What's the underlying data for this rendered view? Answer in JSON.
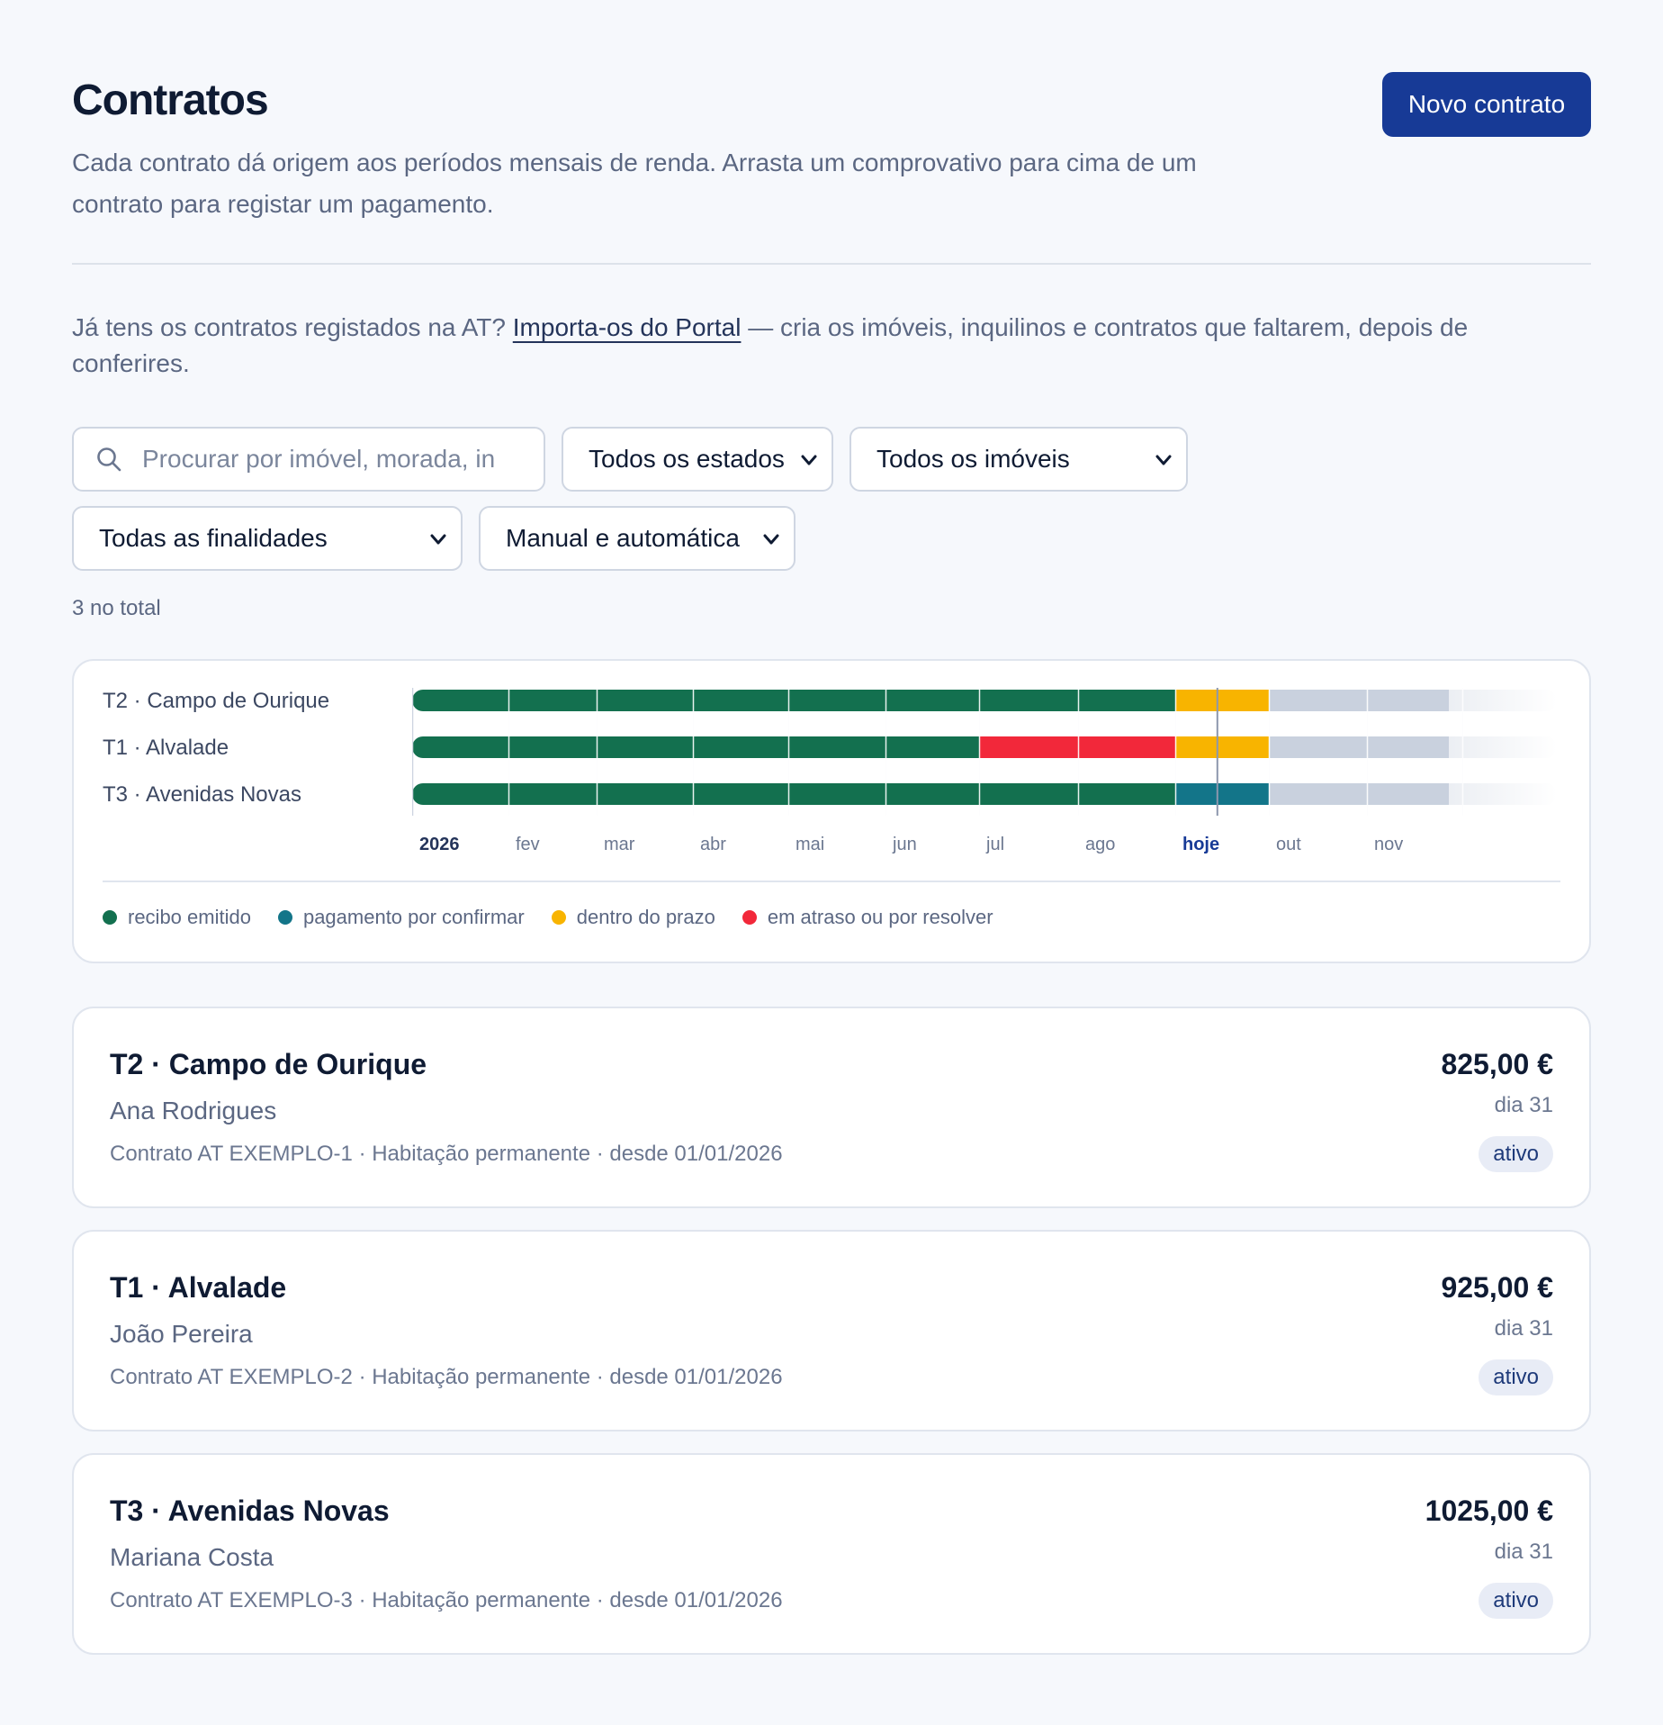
{
  "header": {
    "title": "Contratos",
    "subtitle": "Cada contrato dá origem aos períodos mensais de renda. Arrasta um comprovativo para cima de um contrato para registar um pagamento.",
    "new_button": "Novo contrato"
  },
  "import": {
    "prefix": "Já tens os contratos registados na AT? ",
    "link": "Importa-os do Portal",
    "suffix": " — cria os imóveis, inquilinos e contratos que faltarem, depois de conferires."
  },
  "filters": {
    "search_placeholder": "Procurar por imóvel, morada, in",
    "estados": "Todos os estados",
    "imoveis": "Todos os imóveis",
    "finalidades": "Todas as finalidades",
    "modo": "Manual e automática"
  },
  "count": "3 no total",
  "colors": {
    "recibo_emitido": "#13704f",
    "pagamento_por_confirmar": "#137589",
    "dentro_do_prazo": "#f8b400",
    "em_atraso": "#f2283a",
    "futuro": "#c9d1de",
    "accent": "#173a96"
  },
  "timeline": {
    "rows": [
      {
        "label": "T2 · Campo de Ourique",
        "statuses": [
          "recibo_emitido",
          "recibo_emitido",
          "recibo_emitido",
          "recibo_emitido",
          "recibo_emitido",
          "recibo_emitido",
          "recibo_emitido",
          "recibo_emitido",
          "dentro_do_prazo",
          "futuro",
          "futuro",
          "futuro"
        ]
      },
      {
        "label": "T1 · Alvalade",
        "statuses": [
          "recibo_emitido",
          "recibo_emitido",
          "recibo_emitido",
          "recibo_emitido",
          "recibo_emitido",
          "recibo_emitido",
          "em_atraso",
          "em_atraso",
          "dentro_do_prazo",
          "futuro",
          "futuro",
          "futuro"
        ]
      },
      {
        "label": "T3 · Avenidas Novas",
        "statuses": [
          "recibo_emitido",
          "recibo_emitido",
          "recibo_emitido",
          "recibo_emitido",
          "recibo_emitido",
          "recibo_emitido",
          "recibo_emitido",
          "recibo_emitido",
          "pagamento_por_confirmar",
          "futuro",
          "futuro",
          "futuro"
        ]
      }
    ],
    "months": [
      "2026",
      "fev",
      "mar",
      "abr",
      "mai",
      "jun",
      "jul",
      "ago",
      "hoje",
      "out",
      "nov"
    ],
    "today_index": 8,
    "today_fraction": 0.45
  },
  "legend": [
    {
      "label": "recibo emitido",
      "color": "#13704f"
    },
    {
      "label": "pagamento por confirmar",
      "color": "#137589"
    },
    {
      "label": "dentro do prazo",
      "color": "#f8b400"
    },
    {
      "label": "em atraso ou por resolver",
      "color": "#f2283a"
    }
  ],
  "contracts": [
    {
      "title": "T2 · Campo de Ourique",
      "tenant": "Ana Rodrigues",
      "meta": "Contrato AT EXEMPLO-1 · Habitação permanente · desde 01/01/2026",
      "amount": "825,00 €",
      "day": "dia 31",
      "status": "ativo"
    },
    {
      "title": "T1 · Alvalade",
      "tenant": "João Pereira",
      "meta": "Contrato AT EXEMPLO-2 · Habitação permanente · desde 01/01/2026",
      "amount": "925,00 €",
      "day": "dia 31",
      "status": "ativo"
    },
    {
      "title": "T3 · Avenidas Novas",
      "tenant": "Mariana Costa",
      "meta": "Contrato AT EXEMPLO-3 · Habitação permanente · desde 01/01/2026",
      "amount": "1025,00 €",
      "day": "dia 31",
      "status": "ativo"
    }
  ]
}
